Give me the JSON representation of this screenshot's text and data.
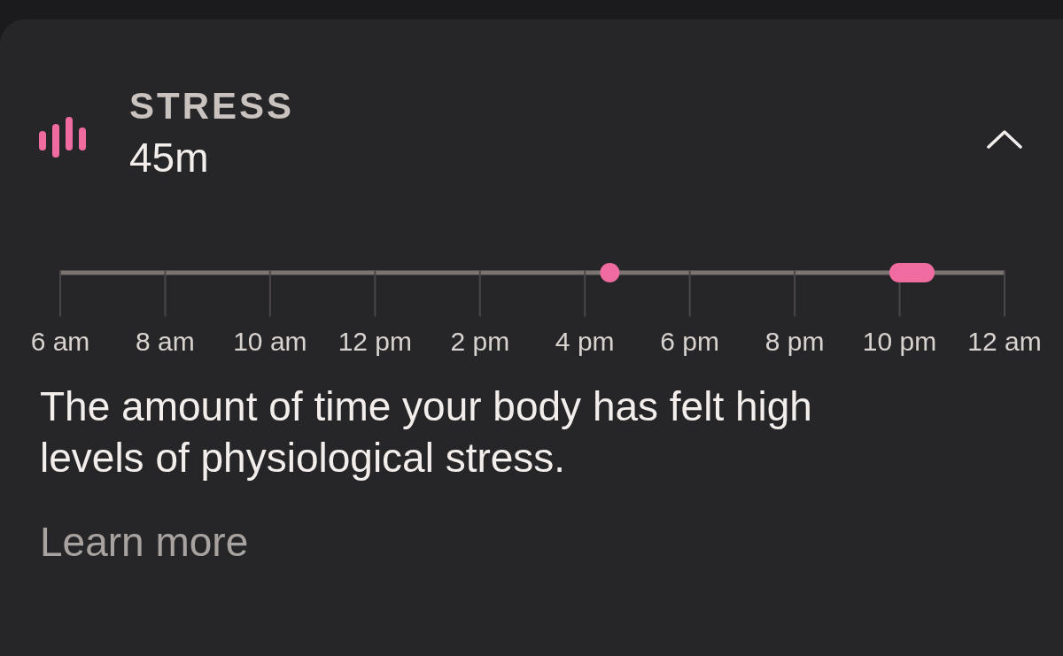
{
  "card": {
    "title": "STRESS",
    "value": "45m",
    "expanded": true,
    "timeline": {
      "axis_labels": [
        "6 am",
        "8 am",
        "10 am",
        "12 pm",
        "2 pm",
        "4 pm",
        "6 pm",
        "8 pm",
        "10 pm",
        "12 am"
      ]
    },
    "description": "The amount of time your body has felt high levels of physiological stress.",
    "link": "Learn more"
  }
}
